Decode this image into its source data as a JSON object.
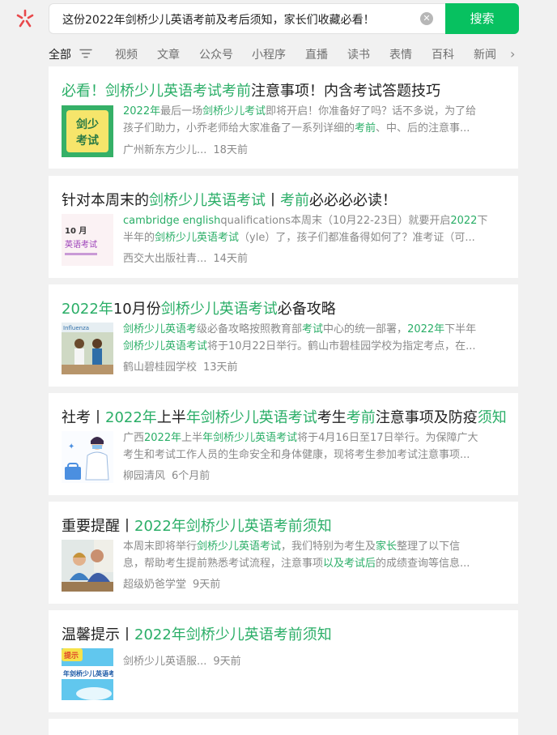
{
  "search": {
    "query": "这份2022年剑桥少儿英语考前及考后须知，家长们收藏必看！",
    "button_label": "搜索"
  },
  "tabs": [
    "全部",
    "视频",
    "文章",
    "公众号",
    "小程序",
    "直播",
    "读书",
    "表情",
    "百科",
    "新闻"
  ],
  "colors": {
    "accent": "#07c160",
    "highlight": "#2aae67"
  },
  "results": [
    {
      "title": [
        [
          "必看！",
          true
        ],
        [
          "剑桥少儿英语考试考前",
          true
        ],
        [
          "注意事项！内含考试答题技巧",
          false
        ]
      ],
      "snippet": [
        [
          [
            "2022年",
            true
          ],
          [
            "最后一场",
            false
          ],
          [
            "剑桥少儿考试",
            true
          ],
          [
            "即将开启！你准备好了吗？话不多说，为了给",
            false
          ]
        ],
        [
          [
            "孩子们助力，小乔老师给大家准备了一系列详细的",
            false
          ],
          [
            "考前",
            true
          ],
          [
            "、中、后的注意事...",
            false
          ]
        ]
      ],
      "source": "广州新东方少儿...",
      "time": "18天前",
      "thumb_text": "剑少考试"
    },
    {
      "title": [
        [
          "针对本周末的",
          false
        ],
        [
          "剑桥少儿英语考试",
          true
        ],
        [
          "丨",
          false
        ],
        [
          "考前",
          true
        ],
        [
          "必必必必读！",
          false
        ]
      ],
      "snippet": [
        [
          [
            "cambridge english",
            true
          ],
          [
            "qualifications本周末（10月22-23日）就要开启",
            false
          ],
          [
            "2022",
            true
          ],
          [
            "下",
            false
          ]
        ],
        [
          [
            "半年的",
            false
          ],
          [
            "剑桥少儿英语考试",
            true
          ],
          [
            "（yle）了，孩子们都准备得如何了？准考证（可...",
            false
          ]
        ]
      ],
      "source": "西交大出版社青...",
      "time": "14天前",
      "thumb_text": "10月 英语考试"
    },
    {
      "title": [
        [
          "2022年",
          true
        ],
        [
          "10月份",
          false
        ],
        [
          "剑桥少儿英语考试",
          true
        ],
        [
          "必备攻略",
          false
        ]
      ],
      "snippet": [
        [
          [
            "剑桥少儿英语考",
            true
          ],
          [
            "级必备攻略按照教育部",
            false
          ],
          [
            "考试",
            true
          ],
          [
            "中心的统一部署，",
            false
          ],
          [
            "2022年",
            true
          ],
          [
            "下半年",
            false
          ]
        ],
        [
          [
            "剑桥少儿英语考试",
            true
          ],
          [
            "将于10月22日举行。鹤山市碧桂园学校为指定考点，在...",
            false
          ]
        ]
      ],
      "source": "鹤山碧桂园学校",
      "time": "13天前",
      "thumb_text": "Influenza"
    },
    {
      "title": [
        [
          "社考丨",
          false
        ],
        [
          "2022年",
          true
        ],
        [
          "上半",
          false
        ],
        [
          "年剑桥少儿英语考试",
          true
        ],
        [
          "考生",
          false
        ],
        [
          "考前",
          true
        ],
        [
          "注意事项及防疫",
          false
        ],
        [
          "须知",
          true
        ]
      ],
      "snippet": [
        [
          [
            "广西",
            false
          ],
          [
            "2022年",
            true
          ],
          [
            "上半",
            false
          ],
          [
            "年剑桥少儿英语考试",
            true
          ],
          [
            "将于4月16日至17日举行。为保障广大",
            false
          ]
        ],
        [
          [
            "考生和考试工作人员的生命安全和身体健康，现将考生参加考试注意事项...",
            false
          ]
        ]
      ],
      "source": "柳园清风",
      "time": "6个月前",
      "thumb_text": ""
    },
    {
      "title": [
        [
          "重要提醒丨",
          false
        ],
        [
          "2022年剑桥少儿英语考前须知",
          true
        ]
      ],
      "snippet": [
        [
          [
            "本周末即将举行",
            false
          ],
          [
            "剑桥少儿英语考试",
            true
          ],
          [
            "，我们特别为考生及",
            false
          ],
          [
            "家长",
            true
          ],
          [
            "整理了以下信",
            false
          ]
        ],
        [
          [
            "息，帮助考生提前熟悉考试流程，注意事项",
            false
          ],
          [
            "以及",
            true
          ],
          [
            "考试后",
            true
          ],
          [
            "的成绩查询等信息...",
            false
          ]
        ]
      ],
      "source": "超级奶爸学堂",
      "time": "9天前",
      "thumb_text": ""
    },
    {
      "title": [
        [
          "温馨提示丨",
          false
        ],
        [
          "2022年剑桥少儿英语考前须知",
          true
        ]
      ],
      "snippet": [],
      "source": "剑桥少儿英语服...",
      "time": "9天前",
      "thumb_text": "提示 年剑桥少儿英语考"
    }
  ]
}
